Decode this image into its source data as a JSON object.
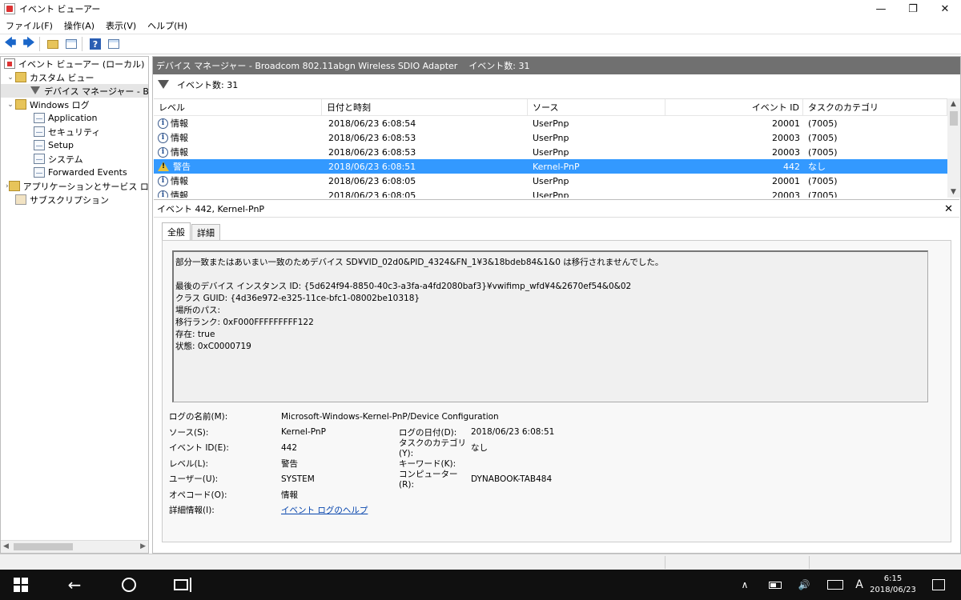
{
  "window": {
    "title": "イベント ビューアー",
    "controls": {
      "minimize": "—",
      "maximize": "❐",
      "close": "✕"
    }
  },
  "menu": [
    "ファイル(F)",
    "操作(A)",
    "表示(V)",
    "ヘルプ(H)"
  ],
  "toolbar": {
    "back": "🡄",
    "forward": "🡆",
    "help": "?"
  },
  "tree": {
    "root": "イベント ビューアー (ローカル)",
    "custom_views": "カスタム ビュー",
    "device_manager": "デバイス マネージャー - Broadc",
    "windows_logs": "Windows ログ",
    "application": "Application",
    "security": "セキュリティ",
    "setup": "Setup",
    "system": "システム",
    "forwarded": "Forwarded Events",
    "apps_services": "アプリケーションとサービス ログ",
    "subscriptions": "サブスクリプション"
  },
  "main": {
    "header_title": "デバイス マネージャー - Broadcom 802.11abgn Wireless SDIO Adapter",
    "header_count": "イベント数: 31",
    "filter_count": "イベント数: 31"
  },
  "grid": {
    "columns": [
      "レベル",
      "日付と時刻",
      "ソース",
      "イベント ID",
      "タスクのカテゴリ"
    ],
    "rows": [
      {
        "level": "情報",
        "icon": "info-icon",
        "date": "2018/06/23 6:08:54",
        "source": "UserPnp",
        "id": "20001",
        "category": "(7005)"
      },
      {
        "level": "情報",
        "icon": "info-icon",
        "date": "2018/06/23 6:08:53",
        "source": "UserPnp",
        "id": "20003",
        "category": "(7005)"
      },
      {
        "level": "情報",
        "icon": "info-icon",
        "date": "2018/06/23 6:08:53",
        "source": "UserPnp",
        "id": "20003",
        "category": "(7005)"
      },
      {
        "level": "警告",
        "icon": "warning-icon",
        "date": "2018/06/23 6:08:51",
        "source": "Kernel-PnP",
        "id": "442",
        "category": "なし"
      },
      {
        "level": "情報",
        "icon": "info-icon",
        "date": "2018/06/23 6:08:05",
        "source": "UserPnp",
        "id": "20001",
        "category": "(7005)"
      },
      {
        "level": "情報",
        "icon": "info-icon",
        "date": "2018/06/23 6:08:05",
        "source": "UserPnp",
        "id": "20003",
        "category": "(7005)"
      }
    ]
  },
  "detail": {
    "title": "イベント 442, Kernel-PnP",
    "close": "✕",
    "tabs": [
      "全般",
      "詳細"
    ],
    "message": [
      "部分一致またはあいまい一致のためデバイス SD¥VID_02d0&PID_4324&FN_1¥3&18bdeb84&1&0 は移行されませんでした。",
      "",
      "最後のデバイス インスタンス ID: {5d624f94-8850-40c3-a3fa-a4fd2080baf3}¥vwifimp_wfd¥4&2670ef54&0&02",
      "クラス GUID: {4d36e972-e325-11ce-bfc1-08002be10318}",
      "場所のパス:",
      "移行ランク: 0xF000FFFFFFFFF122",
      "存在: true",
      "状態: 0xC0000719"
    ],
    "props": {
      "log_name_label": "ログの名前(M):",
      "log_name_value": "Microsoft-Windows-Kernel-PnP/Device Configuration",
      "source_label": "ソース(S):",
      "source_value": "Kernel-PnP",
      "logged_label": "ログの日付(D):",
      "logged_value": "2018/06/23 6:08:51",
      "event_id_label": "イベント ID(E):",
      "event_id_value": "442",
      "task_label": "タスクのカテゴリ(Y):",
      "task_value": "なし",
      "level_label": "レベル(L):",
      "level_value": "警告",
      "keywords_label": "キーワード(K):",
      "keywords_value": "",
      "user_label": "ユーザー(U):",
      "user_value": "SYSTEM",
      "computer_label": "コンピューター(R):",
      "computer_value": "DYNABOOK-TAB484",
      "opcode_label": "オペコード(O):",
      "opcode_value": "情報",
      "more_info_label": "詳細情報(I):",
      "more_info_link": "イベント ログのヘルプ"
    }
  },
  "taskbar": {
    "ime": "A",
    "time": "6:15",
    "date": "2018/06/23",
    "chevron": "∧",
    "volume": "🔊"
  }
}
